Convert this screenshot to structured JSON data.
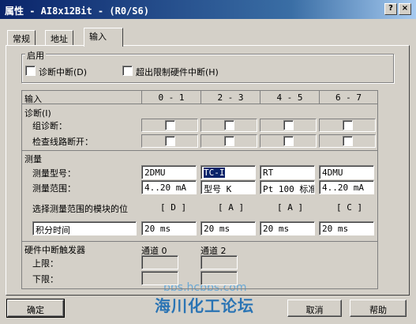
{
  "window": {
    "title": "属性 - AI8x12Bit - (R0/S6)",
    "help_button": "?",
    "close_button": "×"
  },
  "tabs": [
    {
      "label": "常规"
    },
    {
      "label": "地址"
    },
    {
      "label": "输入"
    }
  ],
  "enable": {
    "legend": "启用",
    "diag_interrupt": "诊断中断(D)",
    "limit_interrupt": "超出限制硬件中断(H)"
  },
  "table": {
    "header_label": "输入",
    "channels": [
      "0 - 1",
      "2 - 3",
      "4 - 5",
      "6 - 7"
    ],
    "diagnostics": {
      "title": "诊断(I)",
      "group_label": "组诊断：",
      "wirebreak_label": "检查线路断开："
    },
    "measurement": {
      "title": "测量",
      "type_label": "测量型号：",
      "range_label": "测量范围：",
      "types": [
        "2DMU",
        "TC-I",
        "RT",
        "4DMU"
      ],
      "ranges": [
        "4..20 mA",
        "型号 K",
        "Pt 100 标准",
        "4..20 mA"
      ],
      "module_pos_label": "选择测量范围的模块的位",
      "module_pos": [
        "[ D ]",
        "[ A ]",
        "[ A ]",
        "[ C ]"
      ],
      "integration_label": "积分时间",
      "integration": [
        "20 ms",
        "20 ms",
        "20 ms",
        "20 ms"
      ]
    },
    "trigger": {
      "title": "硬件中断触发器",
      "channel0": "通道 0",
      "channel2": "通道 2",
      "upper": "上限：",
      "lower": "下限："
    }
  },
  "buttons": {
    "ok": "确定",
    "cancel": "取消",
    "help": "帮助"
  },
  "watermark": {
    "url": "bbs.hcbbs.com",
    "name": "海川化工论坛"
  }
}
